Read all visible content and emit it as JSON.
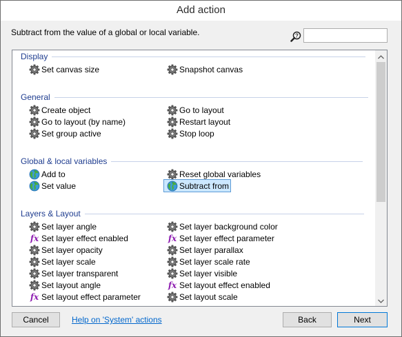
{
  "window": {
    "title": "Add action"
  },
  "description": "Subtract from the value of a global or local variable.",
  "search": {
    "value": "",
    "placeholder": ""
  },
  "categories": [
    {
      "name": "Display",
      "items": [
        {
          "label": "Set canvas size",
          "icon": "gear-icon"
        },
        {
          "label": "Snapshot canvas",
          "icon": "gear-icon"
        }
      ]
    },
    {
      "name": "General",
      "items": [
        {
          "label": "Create object",
          "icon": "gear-icon"
        },
        {
          "label": "Go to layout",
          "icon": "gear-icon"
        },
        {
          "label": "Go to layout (by name)",
          "icon": "gear-icon"
        },
        {
          "label": "Restart layout",
          "icon": "gear-icon"
        },
        {
          "label": "Set group active",
          "icon": "gear-icon"
        },
        {
          "label": "Stop loop",
          "icon": "gear-icon"
        }
      ]
    },
    {
      "name": "Global & local variables",
      "items": [
        {
          "label": "Add to",
          "icon": "globe-icon"
        },
        {
          "label": "Reset global variables",
          "icon": "gear-icon"
        },
        {
          "label": "Set value",
          "icon": "globe-icon"
        },
        {
          "label": "Subtract from",
          "icon": "globe-icon",
          "selected": true
        }
      ]
    },
    {
      "name": "Layers & Layout",
      "items": [
        {
          "label": "Set layer angle",
          "icon": "gear-icon"
        },
        {
          "label": "Set layer background color",
          "icon": "gear-icon"
        },
        {
          "label": "Set layer effect enabled",
          "icon": "fx-icon"
        },
        {
          "label": "Set layer effect parameter",
          "icon": "fx-icon"
        },
        {
          "label": "Set layer opacity",
          "icon": "gear-icon"
        },
        {
          "label": "Set layer parallax",
          "icon": "gear-icon"
        },
        {
          "label": "Set layer scale",
          "icon": "gear-icon"
        },
        {
          "label": "Set layer scale rate",
          "icon": "gear-icon"
        },
        {
          "label": "Set layer transparent",
          "icon": "gear-icon"
        },
        {
          "label": "Set layer visible",
          "icon": "gear-icon"
        },
        {
          "label": "Set layout angle",
          "icon": "gear-icon"
        },
        {
          "label": "Set layout effect enabled",
          "icon": "fx-icon"
        },
        {
          "label": "Set layout effect parameter",
          "icon": "fx-icon"
        },
        {
          "label": "Set layout scale",
          "icon": "gear-icon"
        }
      ]
    }
  ],
  "buttons": {
    "cancel": "Cancel",
    "help": "Help on 'System' actions",
    "back": "Back",
    "next": "Next"
  },
  "colors": {
    "category_text": "#1e3c8f",
    "selection_bg": "#cce8ff",
    "link": "#0066cc",
    "fx": "#8e1fb1"
  }
}
